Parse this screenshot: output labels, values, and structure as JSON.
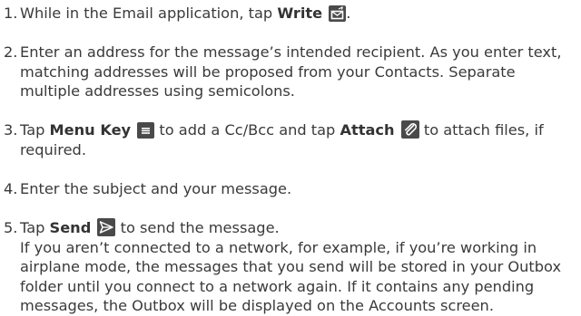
{
  "steps": [
    {
      "num": "1.",
      "pre": "While in the Email application, tap ",
      "key": "Write",
      "icon": "compose-icon",
      "post": "."
    },
    {
      "num": "2.",
      "text": "Enter an address for the message’s intended recipient. As you enter text, matching addresses will be proposed from your Contacts. Separate multiple addresses using semicolons."
    },
    {
      "num": "3.",
      "pre": "Tap ",
      "key1": "Menu Key",
      "icon1": "menu-key-icon",
      "mid": " to add a Cc/Bcc and tap ",
      "key2": "Attach",
      "icon2": "paperclip-icon",
      "post": " to attach files, if required."
    },
    {
      "num": "4.",
      "text": "Enter the subject and your message."
    },
    {
      "num": "5.",
      "pre": "Tap ",
      "key": "Send",
      "icon": "send-icon",
      "post": " to send the message.",
      "note": "If you aren’t connected to a network, for example, if you’re working in airplane mode, the messages that you send will be stored in your Outbox folder until you connect to a network again. If it contains any pending messages, the Outbox will be displayed on the Accounts screen."
    }
  ],
  "colors": {
    "text": "#3a3a3a",
    "icon_bg": "#4a4a4a",
    "icon_fg": "#ffffff"
  }
}
